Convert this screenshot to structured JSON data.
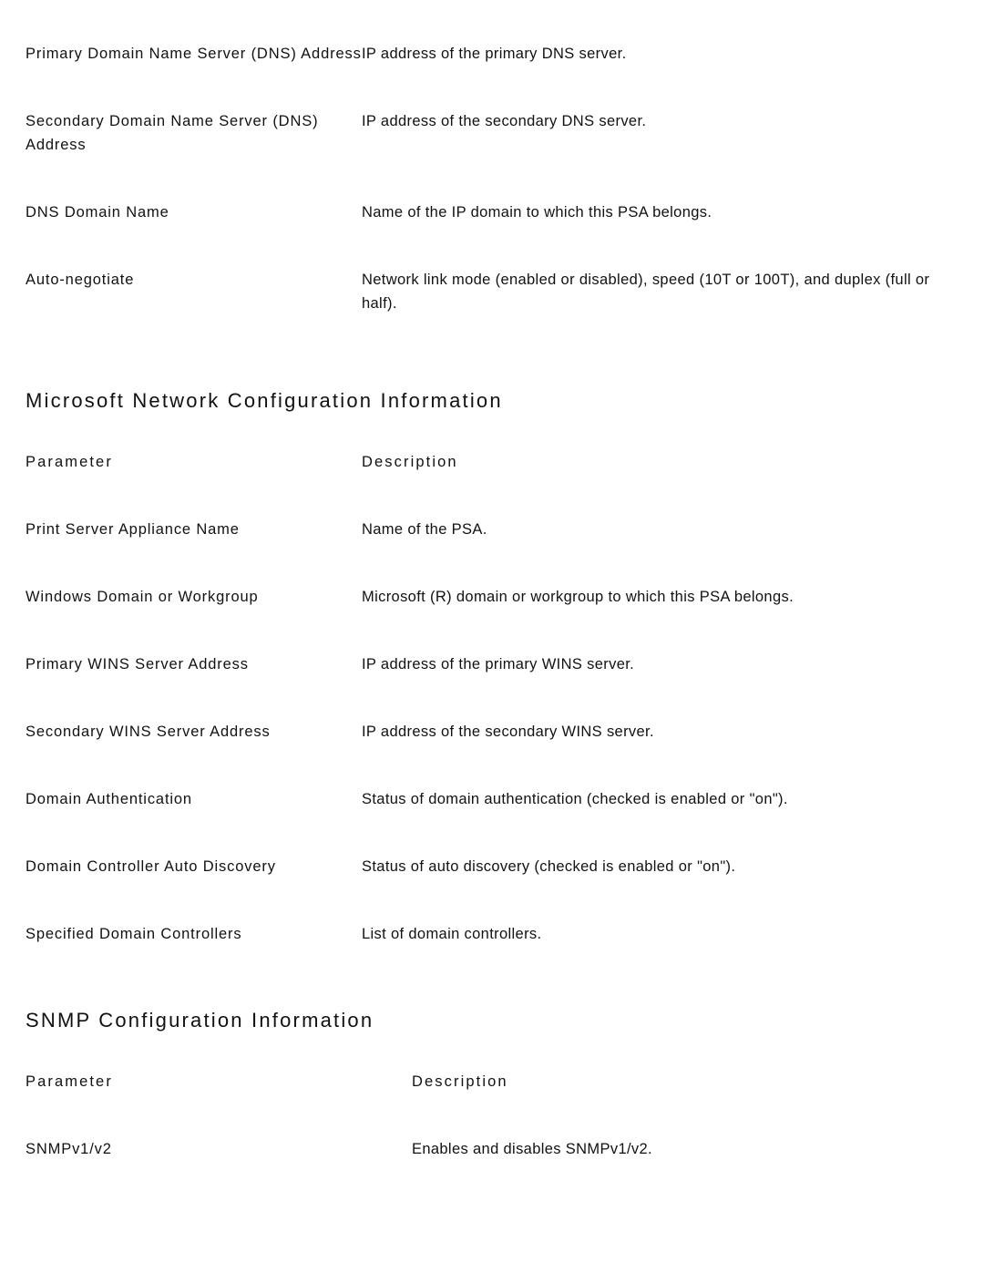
{
  "page": {
    "background_color": "#ffffff",
    "text_color": "#121212"
  },
  "continued_table": {
    "rows": [
      {
        "parameter": "Primary Domain Name Server (DNS) Address",
        "description": "IP address of the primary DNS server."
      },
      {
        "parameter": "Secondary Domain Name Server (DNS) Address",
        "description": "IP address of the secondary DNS server."
      },
      {
        "parameter": "DNS Domain Name",
        "description": "Name of the IP domain to which this PSA belongs."
      },
      {
        "parameter": "Auto-negotiate",
        "description": "Network link mode (enabled or disabled), speed (10T or 100T), and duplex (full or half)."
      }
    ]
  },
  "sections": [
    {
      "title": "Microsoft Network Configuration Information",
      "columns": {
        "parameter": "Parameter",
        "description": "Description"
      },
      "rows": [
        {
          "parameter": "Print Server Appliance Name",
          "description": "Name of the PSA."
        },
        {
          "parameter": "Windows Domain or Workgroup",
          "description": "Microsoft (R) domain or workgroup to which this PSA belongs."
        },
        {
          "parameter": "Primary WINS Server Address",
          "description": "IP address of the primary WINS server."
        },
        {
          "parameter": "Secondary WINS Server Address",
          "description": "IP address of the secondary WINS server."
        },
        {
          "parameter": "Domain Authentication",
          "description": "Status of domain authentication (checked is enabled or \"on\")."
        },
        {
          "parameter": "Domain Controller Auto Discovery",
          "description": "Status of auto discovery (checked is enabled or \"on\")."
        },
        {
          "parameter": "Specified Domain Controllers",
          "description": "List of domain controllers."
        }
      ]
    },
    {
      "title": "SNMP Configuration Information",
      "columns": {
        "parameter": "Parameter",
        "description": "Description"
      },
      "rows": [
        {
          "parameter": "SNMPv1/v2",
          "description": "Enables and disables SNMPv1/v2."
        }
      ]
    }
  ]
}
